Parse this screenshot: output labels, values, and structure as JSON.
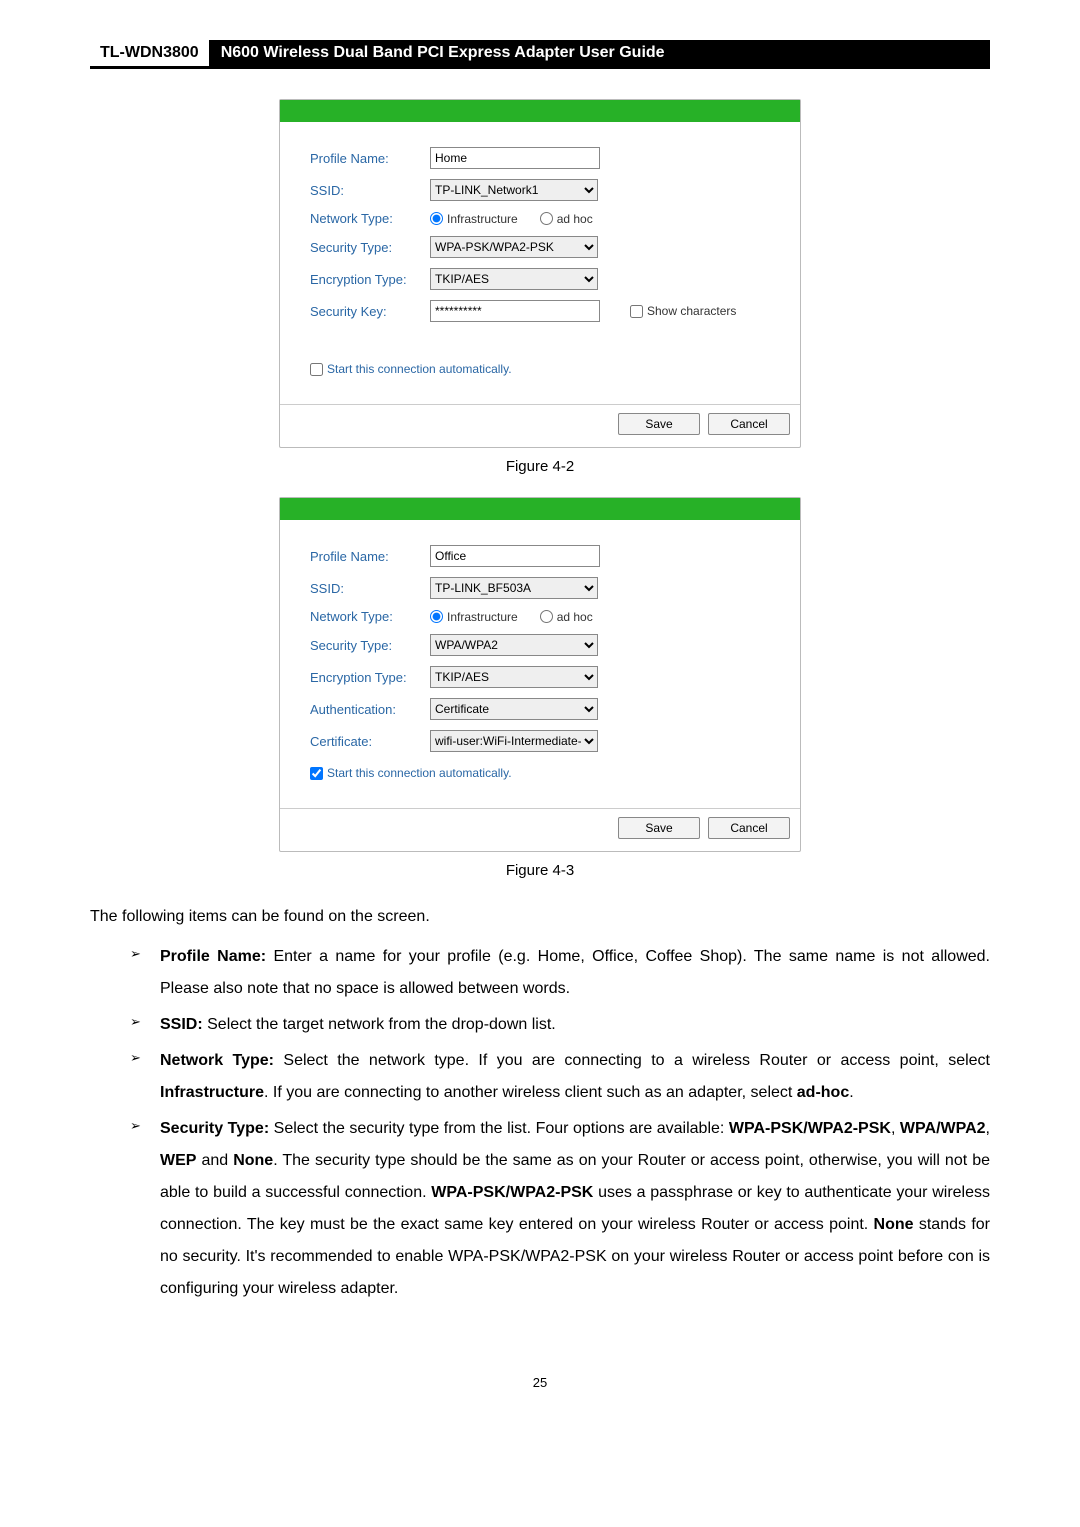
{
  "header": {
    "model": "TL-WDN3800",
    "title": "N600 Wireless Dual Band PCI Express Adapter User Guide"
  },
  "dialog1": {
    "labels": {
      "profile_name": "Profile Name:",
      "ssid": "SSID:",
      "network_type": "Network Type:",
      "security_type": "Security Type:",
      "encryption_type": "Encryption Type:",
      "security_key": "Security Key:"
    },
    "values": {
      "profile_name": "Home",
      "ssid": "TP-LINK_Network1",
      "infrastructure": "Infrastructure",
      "adhoc": "ad hoc",
      "security_type": "WPA-PSK/WPA2-PSK",
      "encryption_type": "TKIP/AES",
      "security_key": "**********"
    },
    "show_characters": "Show characters",
    "auto_label": "Start this connection automatically.",
    "save": "Save",
    "cancel": "Cancel"
  },
  "caption1": "Figure 4-2",
  "dialog2": {
    "labels": {
      "profile_name": "Profile Name:",
      "ssid": "SSID:",
      "network_type": "Network Type:",
      "security_type": "Security Type:",
      "encryption_type": "Encryption Type:",
      "authentication": "Authentication:",
      "certificate": "Certificate:"
    },
    "values": {
      "profile_name": "Office",
      "ssid": "TP-LINK_BF503A",
      "infrastructure": "Infrastructure",
      "adhoc": "ad hoc",
      "security_type": "WPA/WPA2",
      "encryption_type": "TKIP/AES",
      "authentication": "Certificate",
      "certificate": "wifi-user:WiFi-Intermediate-CA-"
    },
    "auto_label": "Start this connection automatically.",
    "save": "Save",
    "cancel": "Cancel"
  },
  "caption2": "Figure 4-3",
  "intro": "The following items can be found on the screen.",
  "bullets": {
    "b1_head": "Profile Name:",
    "b1_tail": " Enter a name for your profile (e.g. Home, Office, Coffee Shop). The same name is not allowed. Please also note that no space is allowed between words.",
    "b2_head": "SSID:",
    "b2_tail": " Select the target network from the drop-down list.",
    "b3_head": "Network Type:",
    "b3_mid1": " Select the network type. If you are connecting to a wireless Router or access point, select ",
    "b3_bold1": "Infrastructure",
    "b3_mid2": ". If you are connecting to another wireless client such as an adapter, select ",
    "b3_bold2": "ad-hoc",
    "b3_end": ".",
    "b4_head": "Security Type:",
    "b4_s1": " Select the security type from the list. Four options are available: ",
    "b4_b1": "WPA-PSK/WPA2-PSK",
    "b4_c1": ", ",
    "b4_b2": "WPA/WPA2",
    "b4_c2": ", ",
    "b4_b3": "WEP",
    "b4_c3": " and ",
    "b4_b4": "None",
    "b4_s2": ". The security type should be the same as on your Router or access point, otherwise, you will not be able to build a successful connection. ",
    "b4_b5": "WPA-PSK/WPA2-PSK",
    "b4_s3": " uses a passphrase or key to authenticate your wireless connection. The key must be the exact same key entered on your wireless Router or access point. ",
    "b4_b6": "None",
    "b4_s4": " stands for no security. It's recommended to enable WPA-PSK/WPA2-PSK on your wireless Router or access point before con is configuring your wireless adapter."
  },
  "page_number": "25"
}
